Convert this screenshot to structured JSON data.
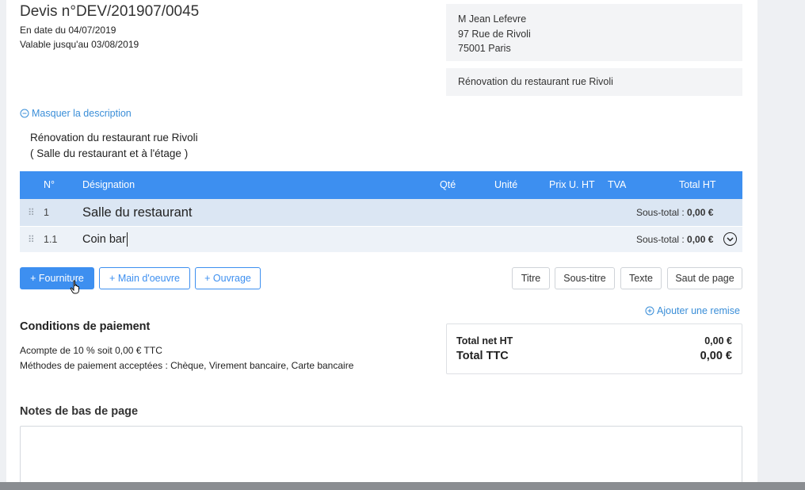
{
  "header": {
    "title": "Devis n°DEV/201907/0045",
    "date": "En date du 04/07/2019",
    "valid_until": "Valable jusqu'au 03/08/2019"
  },
  "client": {
    "name": "M Jean Lefevre",
    "street": "97 Rue de Rivoli",
    "city": "75001 Paris"
  },
  "project": "Rénovation du restaurant rue Rivoli",
  "description": {
    "toggle_label": "Masquer la description",
    "line1": "Rénovation du restaurant rue Rivoli",
    "line2": "( Salle du restaurant et à l'étage )"
  },
  "table": {
    "columns": {
      "num": "N°",
      "designation": "Désignation",
      "qty": "Qté",
      "unit": "Unité",
      "unit_price": "Prix U. HT",
      "vat": "TVA",
      "total": "Total HT"
    },
    "rows": [
      {
        "num": "1",
        "title": "Salle du restaurant",
        "subtotal_label": "Sous-total :",
        "subtotal_value": "0,00 €"
      },
      {
        "num": "1.1",
        "title": "Coin bar",
        "subtotal_label": "Sous-total :",
        "subtotal_value": "0,00 €"
      }
    ]
  },
  "add_buttons": {
    "fourniture": "+ Fourniture",
    "main_oeuvre": "+ Main d'oeuvre",
    "ouvrage": "+ Ouvrage"
  },
  "section_buttons": {
    "titre": "Titre",
    "sous_titre": "Sous-titre",
    "texte": "Texte",
    "saut": "Saut de page"
  },
  "add_discount": "Ajouter une remise",
  "conditions": {
    "title": "Conditions de paiement",
    "deposit": "Acompte de 10 % soit 0,00 € TTC",
    "methods": "Méthodes de paiement acceptées : Chèque, Virement bancaire, Carte bancaire"
  },
  "totals": {
    "net_label": "Total net HT",
    "net_value": "0,00 €",
    "ttc_label": "Total TTC",
    "ttc_value": "0,00 €"
  },
  "notes": {
    "title": "Notes de bas de page"
  },
  "colors": {
    "accent": "#3d8ff0",
    "link": "#3a8ed8",
    "row_section": "#dbe6f3",
    "row_sub": "#edf2f8"
  }
}
